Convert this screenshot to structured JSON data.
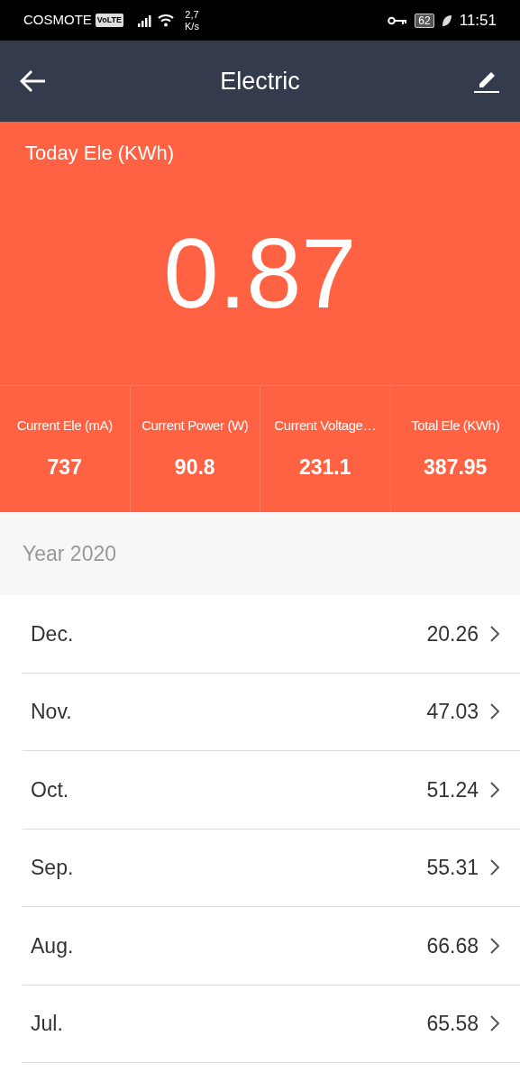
{
  "status_bar": {
    "carrier": "COSMOTE",
    "volte": "VoLTE",
    "speed_value": "2,7",
    "speed_unit": "K/s",
    "battery": "62",
    "time": "11:51"
  },
  "header": {
    "title": "Electric"
  },
  "today": {
    "label": "Today Ele (KWh)",
    "value": "0.87"
  },
  "stats": [
    {
      "label": "Current Ele (mA)",
      "value": "737"
    },
    {
      "label": "Current Power (W)",
      "value": "90.8"
    },
    {
      "label": "Current Voltage…",
      "value": "231.1"
    },
    {
      "label": "Total Ele (KWh)",
      "value": "387.95"
    }
  ],
  "year": "Year 2020",
  "months": [
    {
      "name": "Dec.",
      "value": "20.26"
    },
    {
      "name": "Nov.",
      "value": "47.03"
    },
    {
      "name": "Oct.",
      "value": "51.24"
    },
    {
      "name": "Sep.",
      "value": "55.31"
    },
    {
      "name": "Aug.",
      "value": "66.68"
    },
    {
      "name": "Jul.",
      "value": "65.58"
    }
  ]
}
